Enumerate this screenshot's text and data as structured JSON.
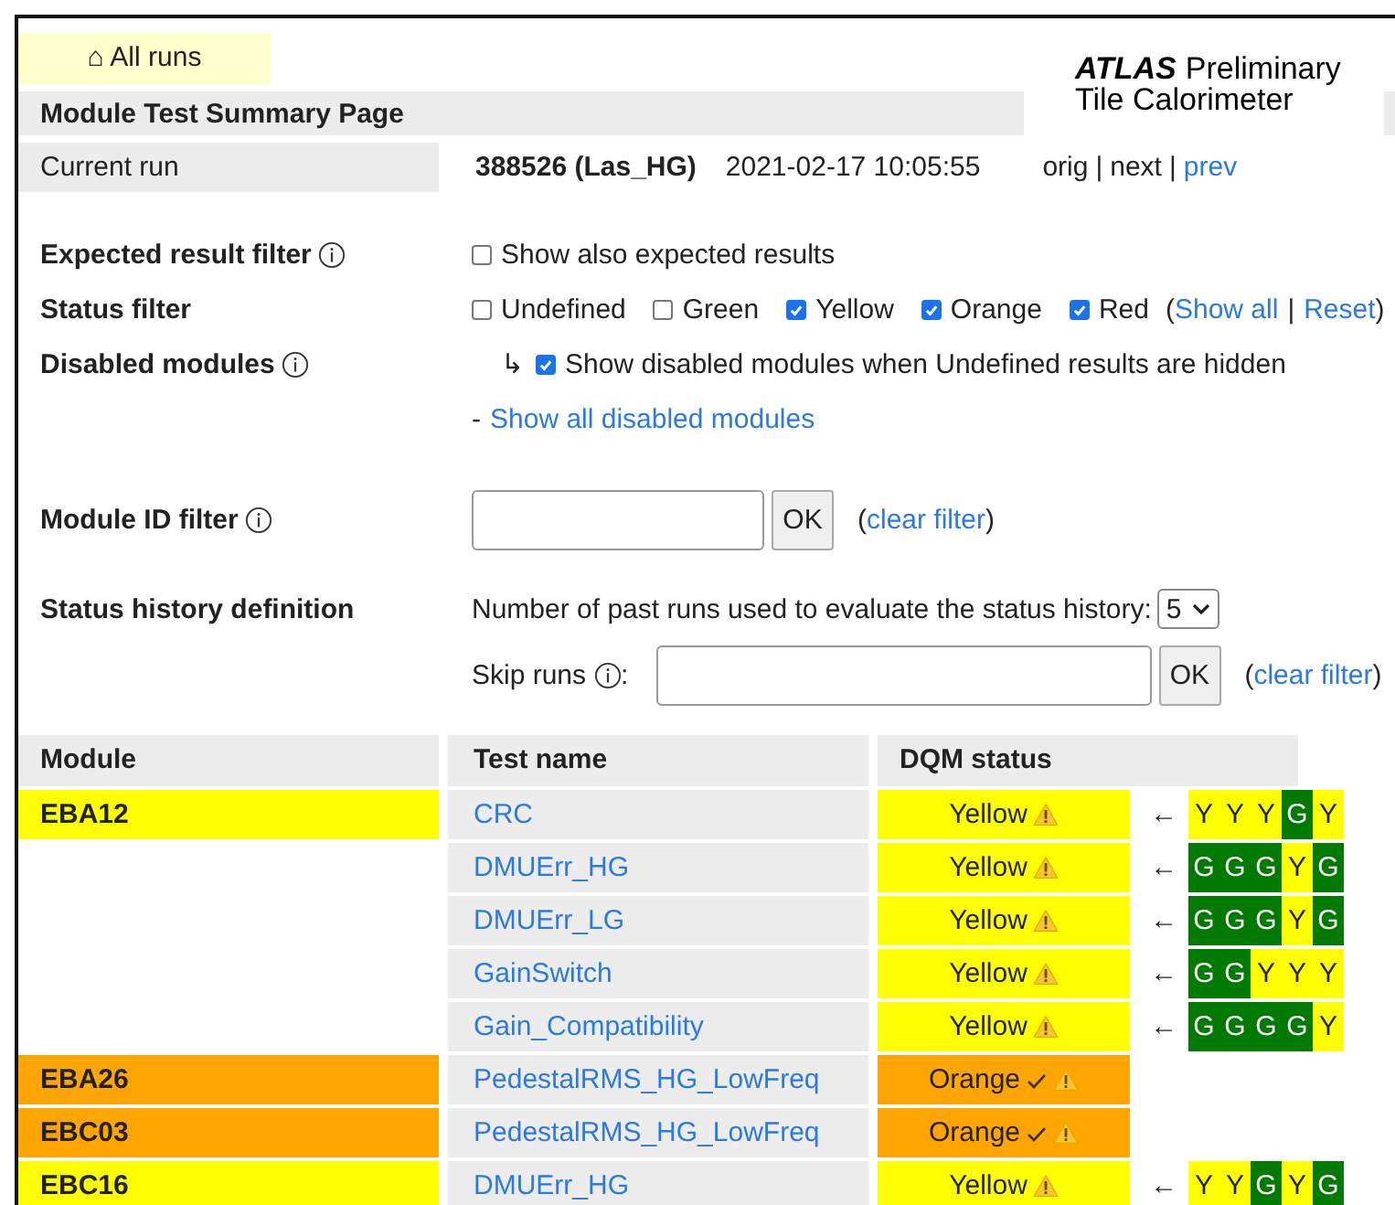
{
  "nav": {
    "label": "⌂ All runs"
  },
  "logo": {
    "title": "ATLAS",
    "subtitle": "Preliminary",
    "line2": "Tile Calorimeter"
  },
  "page_title": "Module Test Summary Page",
  "current_run": {
    "label": "Current run",
    "run": "388526 (Las_HG)",
    "time": "2021-02-17 10:05:55",
    "orig": "orig",
    "next": "next",
    "prev": "prev",
    "sep": "|"
  },
  "filters": {
    "expected": {
      "label": "Expected result filter",
      "option": {
        "label": "Show also expected results",
        "checked": false
      }
    },
    "status": {
      "label": "Status filter",
      "options": [
        {
          "label": "Undefined",
          "checked": false
        },
        {
          "label": "Green",
          "checked": false
        },
        {
          "label": "Yellow",
          "checked": true
        },
        {
          "label": "Orange",
          "checked": true
        },
        {
          "label": "Red",
          "checked": true
        }
      ],
      "open": "(",
      "show_all": "Show all",
      "sep": "|",
      "reset": "Reset",
      "close": ")"
    },
    "disabled": {
      "label": "Disabled modules",
      "arrow": "↳",
      "option": {
        "label": "Show disabled modules when Undefined results are hidden",
        "checked": true
      },
      "dash": "-",
      "link": "Show all disabled modules"
    },
    "module_id": {
      "label": "Module ID filter",
      "button": "OK",
      "open": "(",
      "clear": "clear filter",
      "close": ")"
    },
    "history": {
      "label": "Status history definition",
      "runs_label": "Number of past runs used to evaluate the status history:",
      "runs_value": "5",
      "skip_label": "Skip runs",
      "skip_colon": ":",
      "button": "OK",
      "open": "(",
      "clear": "clear filter",
      "close": ")"
    }
  },
  "table": {
    "columns": [
      "Module",
      "Test name",
      "DQM status"
    ],
    "rows": [
      {
        "module": {
          "name": "EBA12",
          "kind": "yellow"
        },
        "test": "CRC",
        "status": "Yellow",
        "kind": "yellow",
        "acknowledged": false,
        "history": [
          {
            "letter": "Y",
            "kind": "yellow"
          },
          {
            "letter": "Y",
            "kind": "yellow"
          },
          {
            "letter": "Y",
            "kind": "yellow"
          },
          {
            "letter": "G",
            "kind": "green"
          },
          {
            "letter": "Y",
            "kind": "yellow"
          }
        ]
      },
      {
        "test": "DMUErr_HG",
        "status": "Yellow",
        "kind": "yellow",
        "acknowledged": false,
        "history": [
          {
            "letter": "G",
            "kind": "green"
          },
          {
            "letter": "G",
            "kind": "green"
          },
          {
            "letter": "G",
            "kind": "green"
          },
          {
            "letter": "Y",
            "kind": "yellow"
          },
          {
            "letter": "G",
            "kind": "green"
          }
        ]
      },
      {
        "test": "DMUErr_LG",
        "status": "Yellow",
        "kind": "yellow",
        "acknowledged": false,
        "history": [
          {
            "letter": "G",
            "kind": "green"
          },
          {
            "letter": "G",
            "kind": "green"
          },
          {
            "letter": "G",
            "kind": "green"
          },
          {
            "letter": "Y",
            "kind": "yellow"
          },
          {
            "letter": "G",
            "kind": "green"
          }
        ]
      },
      {
        "test": "GainSwitch",
        "status": "Yellow",
        "kind": "yellow",
        "acknowledged": false,
        "history": [
          {
            "letter": "G",
            "kind": "green"
          },
          {
            "letter": "G",
            "kind": "green"
          },
          {
            "letter": "Y",
            "kind": "yellow"
          },
          {
            "letter": "Y",
            "kind": "yellow"
          },
          {
            "letter": "Y",
            "kind": "yellow"
          }
        ]
      },
      {
        "test": "Gain_Compatibility",
        "status": "Yellow",
        "kind": "yellow",
        "acknowledged": false,
        "history": [
          {
            "letter": "G",
            "kind": "green"
          },
          {
            "letter": "G",
            "kind": "green"
          },
          {
            "letter": "G",
            "kind": "green"
          },
          {
            "letter": "G",
            "kind": "green"
          },
          {
            "letter": "Y",
            "kind": "yellow"
          }
        ]
      },
      {
        "module": {
          "name": "EBA26",
          "kind": "orange"
        },
        "test": "PedestalRMS_HG_LowFreq",
        "status": "Orange",
        "kind": "orange",
        "acknowledged": true
      },
      {
        "module": {
          "name": "EBC03",
          "kind": "orange"
        },
        "test": "PedestalRMS_HG_LowFreq",
        "status": "Orange",
        "kind": "orange",
        "acknowledged": true
      },
      {
        "module": {
          "name": "EBC16",
          "kind": "yellow"
        },
        "test": "DMUErr_HG",
        "status": "Yellow",
        "kind": "yellow",
        "acknowledged": false,
        "history": [
          {
            "letter": "Y",
            "kind": "yellow"
          },
          {
            "letter": "Y",
            "kind": "yellow"
          },
          {
            "letter": "G",
            "kind": "green"
          },
          {
            "letter": "Y",
            "kind": "yellow"
          },
          {
            "letter": "G",
            "kind": "green"
          }
        ]
      }
    ],
    "history_arrow": "←"
  }
}
